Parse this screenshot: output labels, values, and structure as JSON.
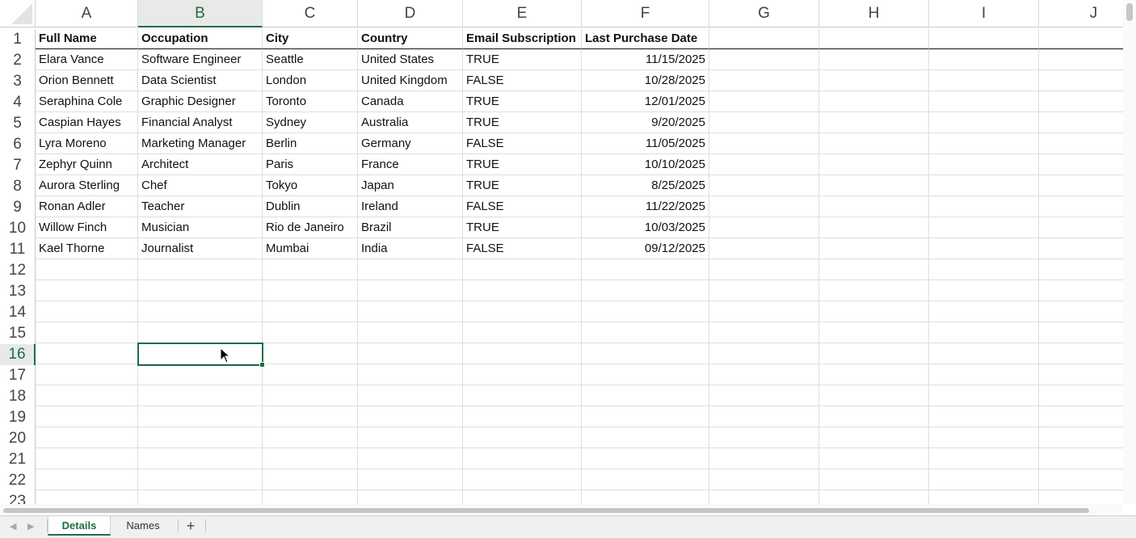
{
  "columns": [
    "A",
    "B",
    "C",
    "D",
    "E",
    "F",
    "G",
    "H",
    "I",
    "J"
  ],
  "active_column": "B",
  "active_row": 16,
  "row_numbers": [
    1,
    2,
    3,
    4,
    5,
    6,
    7,
    8,
    9,
    10,
    11,
    12,
    13,
    14,
    15,
    16,
    17,
    18,
    19,
    20,
    21,
    22,
    23
  ],
  "table": {
    "headers": [
      "Full Name",
      "Occupation",
      "City",
      "Country",
      "Email Subscription",
      "Last Purchase Date"
    ],
    "rows": [
      [
        "Elara Vance",
        "Software Engineer",
        "Seattle",
        "United States",
        "TRUE",
        "11/15/2025"
      ],
      [
        "Orion Bennett",
        "Data Scientist",
        "London",
        "United Kingdom",
        "FALSE",
        "10/28/2025"
      ],
      [
        "Seraphina Cole",
        "Graphic Designer",
        "Toronto",
        "Canada",
        "TRUE",
        "12/01/2025"
      ],
      [
        "Caspian Hayes",
        "Financial Analyst",
        "Sydney",
        "Australia",
        "TRUE",
        "9/20/2025"
      ],
      [
        "Lyra Moreno",
        "Marketing Manager",
        "Berlin",
        "Germany",
        "FALSE",
        "11/05/2025"
      ],
      [
        "Zephyr Quinn",
        "Architect",
        "Paris",
        "France",
        "TRUE",
        "10/10/2025"
      ],
      [
        "Aurora Sterling",
        "Chef",
        "Tokyo",
        "Japan",
        "TRUE",
        "8/25/2025"
      ],
      [
        "Ronan Adler",
        "Teacher",
        "Dublin",
        "Ireland",
        "FALSE",
        "11/22/2025"
      ],
      [
        "Willow Finch",
        "Musician",
        "Rio de Janeiro",
        "Brazil",
        "TRUE",
        "10/03/2025"
      ],
      [
        "Kael Thorne",
        "Journalist",
        "Mumbai",
        "India",
        "FALSE",
        "09/12/2025"
      ]
    ]
  },
  "sheet_tabs": [
    {
      "label": "Details",
      "active": true
    },
    {
      "label": "Names",
      "active": false
    }
  ],
  "add_sheet_label": "+",
  "colors": {
    "accent": "#1e6e42"
  }
}
